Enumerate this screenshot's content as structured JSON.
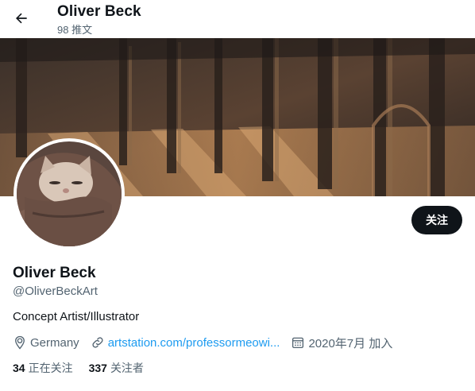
{
  "header": {
    "back_icon": "arrow-left-icon",
    "title": "Oliver Beck",
    "subtitle": "98 推文"
  },
  "banner": {
    "description_colors": [
      "#2b2420",
      "#6b4a34",
      "#c08a5a",
      "#e0b07a"
    ]
  },
  "profile": {
    "name": "Oliver Beck",
    "handle": "@OliverBeckArt",
    "bio": "Concept Artist/Illustrator",
    "follow_label": "关注",
    "location_icon": "location-pin-icon",
    "location": "Germany",
    "link_icon": "link-icon",
    "website": "artstation.com/professormeowi...",
    "calendar_icon": "calendar-icon",
    "joined": "2020年7月 加入"
  },
  "stats": {
    "following_count": "34",
    "following_label": "正在关注",
    "followers_count": "337",
    "followers_label": "关注者"
  },
  "colors": {
    "text_primary": "#0f1419",
    "text_secondary": "#536471",
    "link": "#1d9bf0",
    "button_bg": "#0f1419"
  }
}
